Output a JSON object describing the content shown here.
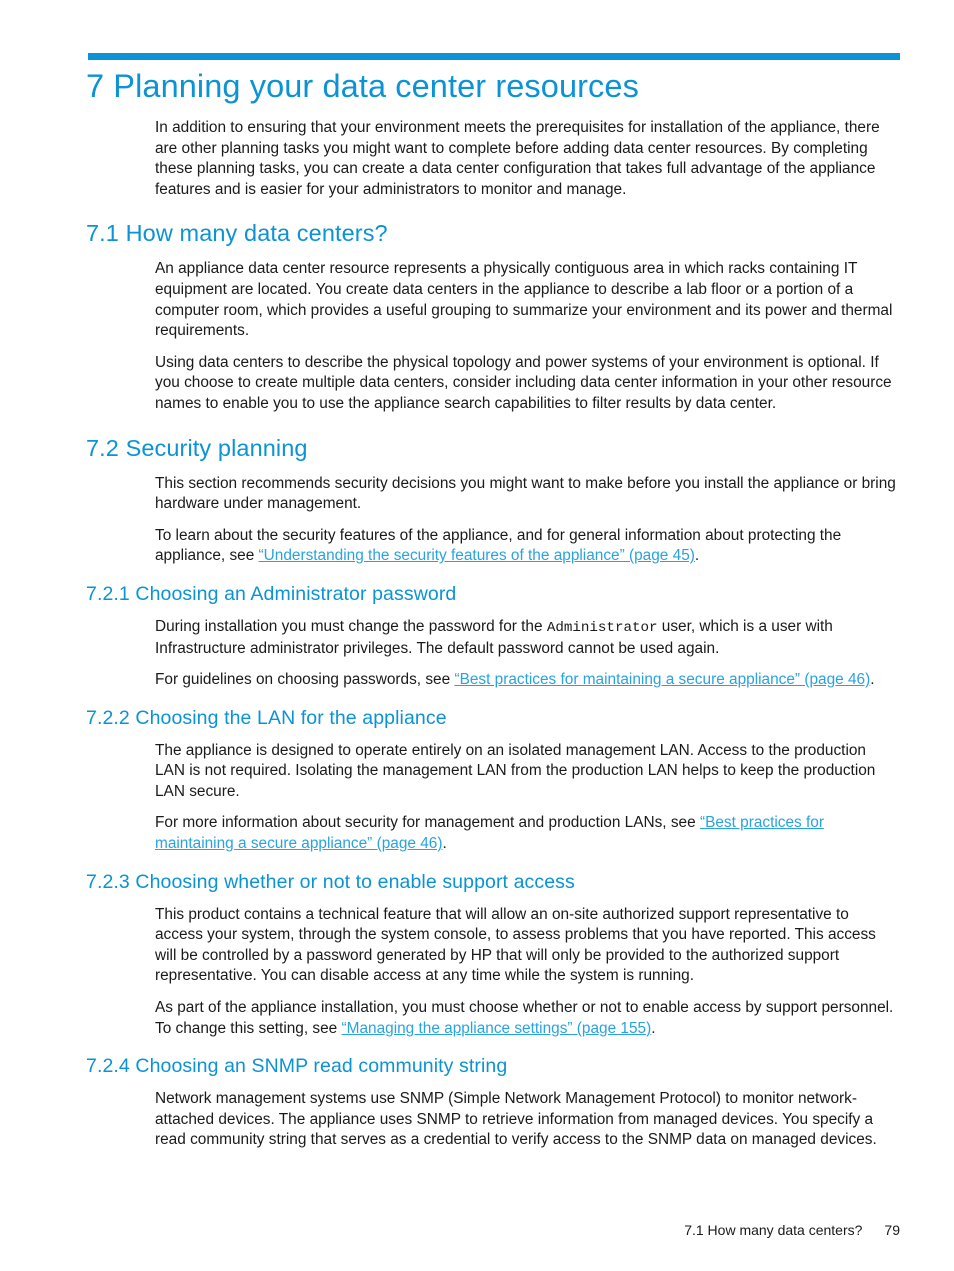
{
  "colors": {
    "accent": "#0b93d5",
    "link": "#29a3e0",
    "text": "#1a1a1a",
    "page_background": "#ffffff"
  },
  "chapter": {
    "number": "7",
    "title": "7 Planning your data center resources",
    "intro": "In addition to ensuring that your environment meets the prerequisites for installation of the appliance, there are other planning tasks you might want to complete before adding data center resources. By completing these planning tasks, you can create a data center configuration that takes full advantage of the appliance features and is easier for your administrators to monitor and manage."
  },
  "sections": {
    "s71": {
      "heading": "7.1 How many data centers?",
      "p1": "An appliance data center resource represents a physically contiguous area in which racks containing IT equipment are located. You create data centers in the appliance to describe a lab floor or a portion of a computer room, which provides a useful grouping to summarize your environment and its power and thermal requirements.",
      "p2": "Using data centers to describe the physical topology and power systems of your environment is optional. If you choose to create multiple data centers, consider including data center information in your other resource names to enable you to use the appliance search capabilities to filter results by data center."
    },
    "s72": {
      "heading": "7.2 Security planning",
      "p1": "This section recommends security decisions you might want to make before you install the appliance or bring hardware under management.",
      "p2_lead": "To learn about the security features of the appliance, and for general information about protecting the appliance, see ",
      "p2_link": "“Understanding the security features of the appliance” (page 45)",
      "p2_tail": "."
    },
    "s721": {
      "heading": "7.2.1 Choosing an Administrator password",
      "p1_lead": "During installation you must change the password for the ",
      "p1_mono": "Administrator",
      "p1_tail": " user, which is a user with Infrastructure administrator privileges. The default password cannot be used again.",
      "p2_lead": "For guidelines on choosing passwords, see ",
      "p2_link": "“Best practices for maintaining a secure appliance” (page 46)",
      "p2_tail": "."
    },
    "s722": {
      "heading": "7.2.2 Choosing the LAN for the appliance",
      "p1": "The appliance is designed to operate entirely on an isolated management LAN. Access to the production LAN is not required. Isolating the management LAN from the production LAN helps to keep the production LAN secure.",
      "p2_lead": "For more information about security for management and production LANs, see ",
      "p2_link": "“Best practices for maintaining a secure appliance” (page 46)",
      "p2_tail": "."
    },
    "s723": {
      "heading": "7.2.3 Choosing whether or not to enable support access",
      "p1": "This product contains a technical feature that will allow an on-site authorized support representative to access your system, through the system console, to assess problems that you have reported. This access will be controlled by a password generated by HP that will only be provided to the authorized support representative. You can disable access at any time while the system is running.",
      "p2_lead": "As part of the appliance installation, you must choose whether or not to enable access by support personnel. To change this setting, see ",
      "p2_link": "“Managing the appliance settings” (page 155)",
      "p2_tail": "."
    },
    "s724": {
      "heading": "7.2.4 Choosing an SNMP read community string",
      "p1": "Network management systems use SNMP (Simple Network Management Protocol) to monitor network-attached devices. The appliance uses SNMP to retrieve information from managed devices. You specify a read community string that serves as a credential to verify access to the SNMP data on managed devices."
    }
  },
  "footer": {
    "title": "7.1 How many data centers?",
    "page_number": "79"
  }
}
